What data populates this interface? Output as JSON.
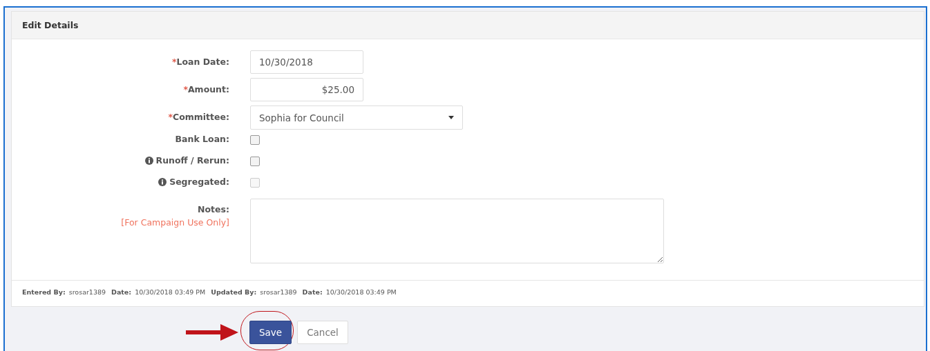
{
  "panel": {
    "title": "Edit Details"
  },
  "fields": [
    {
      "kind": "text",
      "mark": "*",
      "label": "Loan Date:",
      "value": "10/30/2018"
    },
    {
      "kind": "money",
      "mark": "*",
      "label": "Amount:",
      "value": "$25.00"
    },
    {
      "kind": "select",
      "mark": "*",
      "label": "Committee:",
      "value": "Sophia for Council"
    },
    {
      "kind": "checkbox",
      "label": "Bank Loan:",
      "info": false,
      "checked": false,
      "disabled": false
    },
    {
      "kind": "checkbox",
      "label": "Runoff / Rerun:",
      "info": true,
      "checked": false,
      "disabled": false
    },
    {
      "kind": "checkbox",
      "label": "Segregated:",
      "info": true,
      "checked": false,
      "disabled": true
    },
    {
      "kind": "textarea",
      "label": "Notes:",
      "note": "[For Campaign Use Only]"
    }
  ],
  "audit": [
    {
      "label": "Entered By:",
      "value": "srosar1389"
    },
    {
      "label": "Date:",
      "value": "10/30/2018 03:49 PM"
    },
    {
      "label": "Updated By:",
      "value": "srosar1389"
    },
    {
      "label": "Date:",
      "value": "10/30/2018 03:49 PM"
    }
  ],
  "buttons": [
    {
      "label": "Save",
      "kind": "primary",
      "highlighted": true
    },
    {
      "label": "Cancel",
      "kind": "default",
      "highlighted": false
    }
  ]
}
